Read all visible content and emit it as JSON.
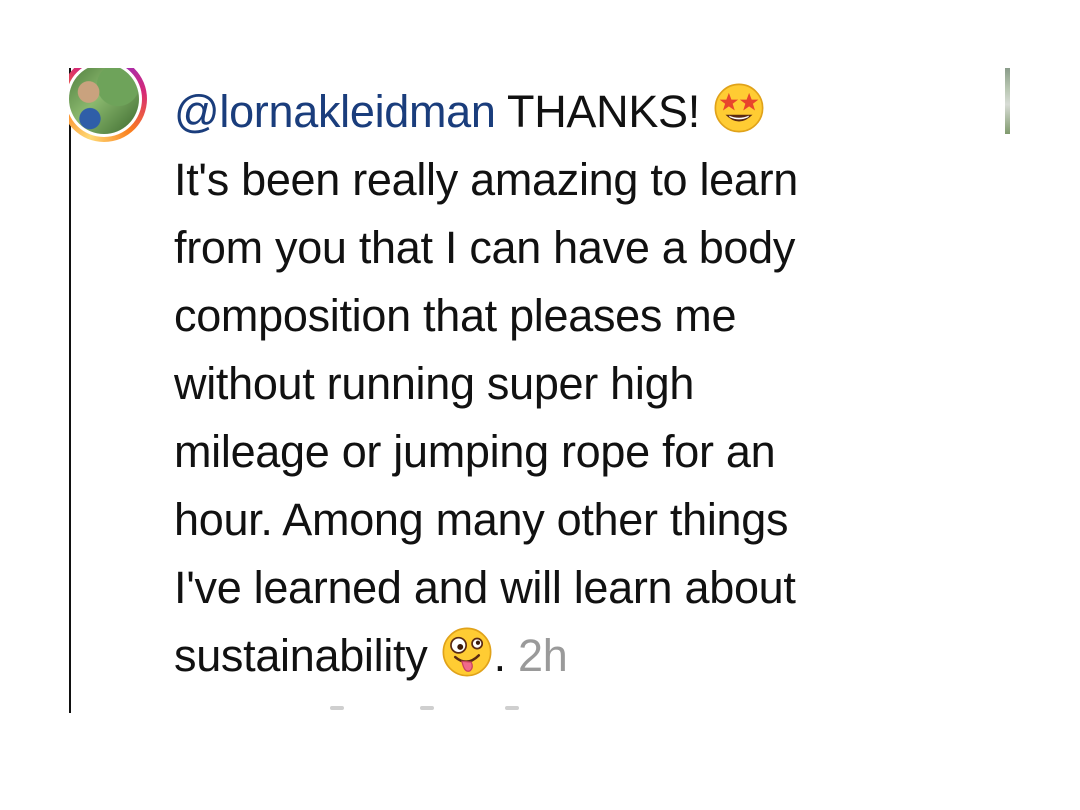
{
  "comment": {
    "username": "@lornakleidman",
    "line1_after_mention": " THANKS! ",
    "line1_emoji": "star-struck",
    "line2": "It's been really amazing to learn",
    "line3": "from you that I can have a body",
    "line4": "composition that pleases me",
    "line5": "without running super high",
    "line6": "mileage or jumping rope for an",
    "line7": "hour. Among many other things",
    "line8": "I've learned and will learn about",
    "line9": "sustainability ",
    "line9_emoji": "zany-face",
    "line9_suffix": ". ",
    "timestamp": "2h"
  },
  "colors": {
    "mention": "#1a3d7c",
    "text": "#111111",
    "timestamp": "#9a9a9a"
  }
}
